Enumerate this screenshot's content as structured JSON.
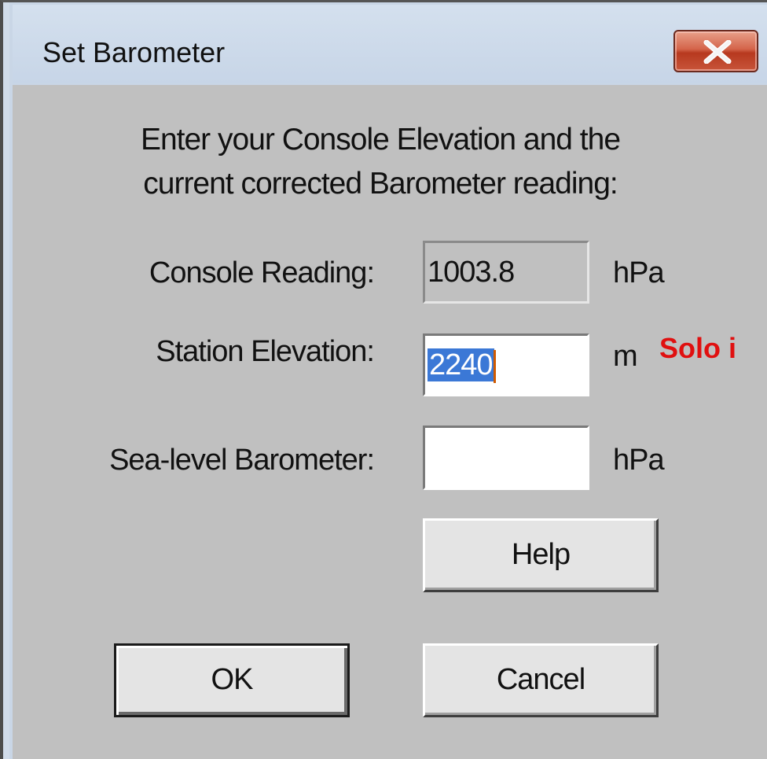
{
  "window": {
    "title": "Set Barometer",
    "close_icon": "close-icon"
  },
  "instructions": {
    "line1": "Enter your Console Elevation and the",
    "line2": "current corrected Barometer reading:"
  },
  "console_reading": {
    "label": "Console Reading:",
    "value": "1003.8",
    "unit": "hPa"
  },
  "station_elevation": {
    "label": "Station Elevation:",
    "value": "2240",
    "unit": "m"
  },
  "sea_level_barometer": {
    "label": "Sea-level Barometer:",
    "value": "",
    "unit": "hPa"
  },
  "buttons": {
    "help": "Help",
    "ok": "OK",
    "cancel": "Cancel"
  },
  "annotation": {
    "text": "Solo i",
    "color": "#e01010"
  },
  "colors": {
    "titlebar": "#c9d6e6",
    "client_bg": "#c0c0c0",
    "close_button": "#c8553a",
    "selection": "#3b78d6"
  }
}
